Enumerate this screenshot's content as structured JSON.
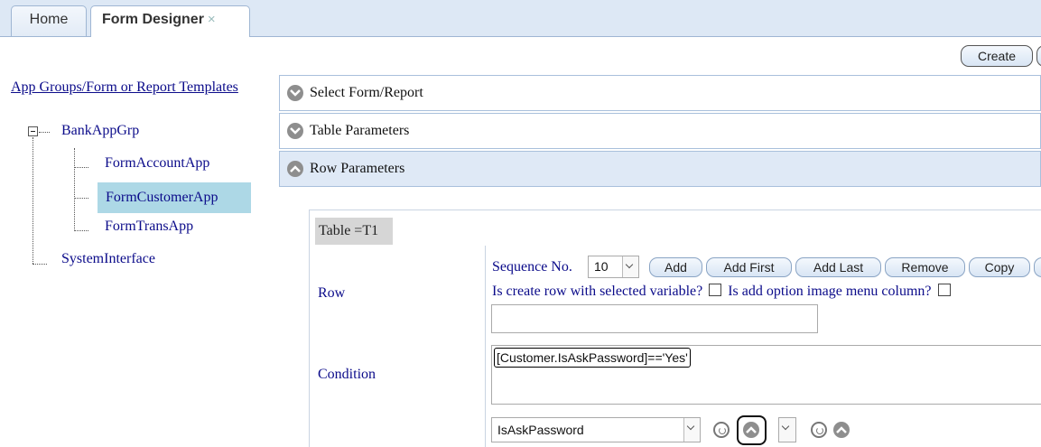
{
  "tabs": [
    {
      "label": "Home"
    },
    {
      "label": "Form Designer",
      "close": "×"
    }
  ],
  "toolbar": {
    "create_label": "Create"
  },
  "tree": {
    "root_label": "App Groups/Form or Report Templates",
    "groups": [
      {
        "label": "BankAppGrp",
        "expanded": true,
        "children": [
          "FormAccountApp",
          "FormCustomerApp",
          "FormTransApp"
        ]
      },
      {
        "label": "SystemInterface"
      }
    ],
    "selected": "FormCustomerApp"
  },
  "accordion": [
    {
      "label": "Select Form/Report",
      "icon": "chevron-down-icon"
    },
    {
      "label": "Table Parameters",
      "icon": "chevron-down-icon"
    },
    {
      "label": "Row Parameters",
      "icon": "chevron-up-icon",
      "active": true
    }
  ],
  "row_params": {
    "table_label": "Table =T1",
    "row_label": "Row",
    "condition_label": "Condition",
    "sequence_label": "Sequence No.",
    "sequence_value": "10",
    "buttons": [
      "Add",
      "Add First",
      "Add Last",
      "Remove",
      "Copy"
    ],
    "chk_selected_variable": "Is create row with selected variable?",
    "chk_option_image": "Is add option image menu column?",
    "row_text_value": "",
    "condition_value": "[Customer.IsAskPassword]=='Yes'",
    "variable_select": "IsAskPassword"
  },
  "colors": {
    "tabbar": "#dde8f5",
    "link": "#0b0b8a",
    "selected_bg": "#add8e6",
    "accordion_active": "#dfe9f6"
  }
}
